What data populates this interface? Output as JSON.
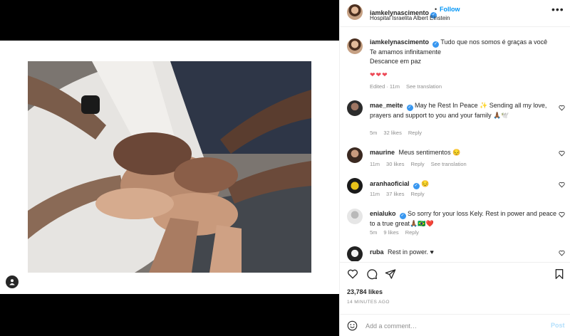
{
  "post": {
    "username": "iamkelynascimento",
    "verified_mark": "✓",
    "separator": "•",
    "follow_label": "Follow",
    "location": "Hospital Israelita Albert Einstein",
    "more_icon": "more-horizontal-icon"
  },
  "caption": {
    "username": "iamkelynascimento",
    "lines": [
      "Tudo que nos somos é graças a você",
      "Te amamos infinitamente",
      "Descance em paz"
    ],
    "hearts": "❤❤❤",
    "edited": "Edited · 11m",
    "see_translation": "See translation"
  },
  "comments": [
    {
      "username": "mae_meite",
      "verified": true,
      "text": "May he Rest In Peace ✨ Sending all my love, prayers and support to you and your family 🙏🏾🕊️",
      "time": "5m",
      "likes": "32 likes",
      "reply": "Reply",
      "translation": ""
    },
    {
      "username": "maurine",
      "verified": false,
      "text": "Meus sentimentos 😔",
      "time": "11m",
      "likes": "30 likes",
      "reply": "Reply",
      "translation": "See translation"
    },
    {
      "username": "aranhaoficial",
      "verified": true,
      "text": "😔",
      "time": "11m",
      "likes": "37 likes",
      "reply": "Reply",
      "translation": ""
    },
    {
      "username": "enialuko",
      "verified": true,
      "text": "So sorry for your loss Kely. Rest in power and peace to a true great🙏🏾🇧🇷❤️",
      "time": "5m",
      "likes": "9 likes",
      "reply": "Reply",
      "translation": ""
    },
    {
      "username": "ruba",
      "verified": false,
      "text": "Rest in power. ♥",
      "time": "",
      "likes": "",
      "reply": "",
      "translation": ""
    }
  ],
  "actions": {
    "like_icon": "heart-icon",
    "comment_icon": "comment-icon",
    "share_icon": "paper-plane-icon",
    "save_icon": "bookmark-icon",
    "likes": "23,784 likes",
    "timestamp": "14 MINUTES AGO"
  },
  "add_comment": {
    "placeholder": "Add a comment…",
    "post_label": "Post"
  },
  "colors": {
    "link_blue": "#0095f6",
    "verified_blue": "#3897f0",
    "heart_red": "#ed4956",
    "muted": "#8e8e8e"
  }
}
